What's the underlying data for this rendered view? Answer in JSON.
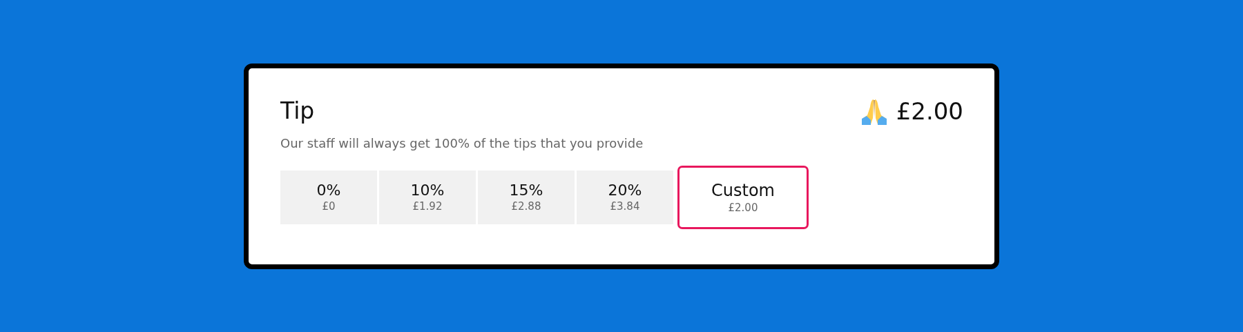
{
  "title": "Tip",
  "amount": "£2.00",
  "subtitle": "Our staff will always get 100% of the tips that you provide",
  "options": [
    {
      "label": "0%",
      "value": "£0",
      "selected": false
    },
    {
      "label": "10%",
      "value": "£1.92",
      "selected": false
    },
    {
      "label": "15%",
      "value": "£2.88",
      "selected": false
    },
    {
      "label": "20%",
      "value": "£3.84",
      "selected": false
    },
    {
      "label": "Custom",
      "value": "£2.00",
      "selected": true
    }
  ]
}
